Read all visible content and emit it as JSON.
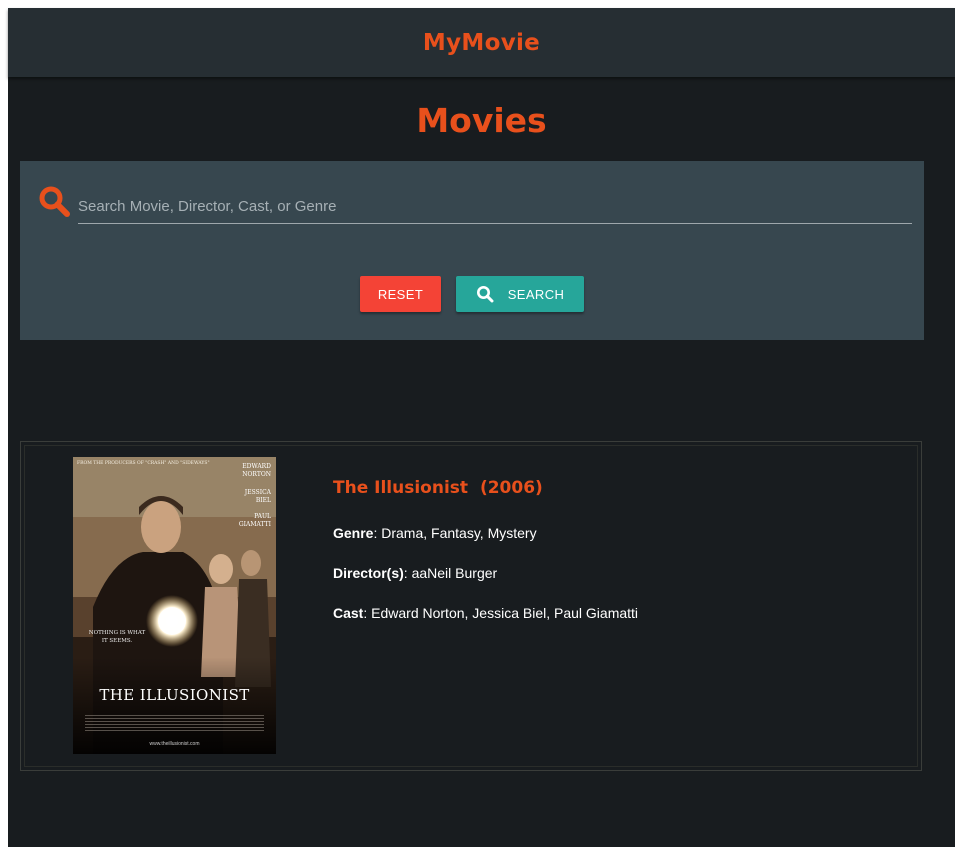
{
  "header": {
    "brand": "MyMovie"
  },
  "page": {
    "title": "Movies"
  },
  "search": {
    "placeholder": "Search Movie, Director, Cast, or Genre",
    "value": "",
    "reset_label": "RESET",
    "search_label": "SEARCH",
    "icon": "search-icon"
  },
  "results": [
    {
      "title": "The Illusionist",
      "year": "(2006)",
      "genre_label": "Genre",
      "genre": "Drama, Fantasy, Mystery",
      "director_label": "Director(s)",
      "director": "aaNeil Burger",
      "cast_label": "Cast",
      "cast": "Edward Norton, Jessica Biel, Paul Giamatti",
      "poster": {
        "tagline_top": "FROM THE PRODUCERS OF \"CRASH\" AND \"SIDEWAYS\"",
        "credit_1": "EDWARD NORTON",
        "credit_2": "JESSICA BIEL",
        "credit_3": "PAUL GIAMATTI",
        "tagline": "NOTHING IS WHAT IT SEEMS.",
        "title": "THE ILLUSIONIST",
        "url": "www.theillusionist.com"
      }
    }
  ],
  "colors": {
    "accent": "#e8501c",
    "background": "#181c1f",
    "topbar": "#262e33",
    "panel": "#37474f",
    "reset": "#f44336",
    "search": "#26a69a"
  }
}
